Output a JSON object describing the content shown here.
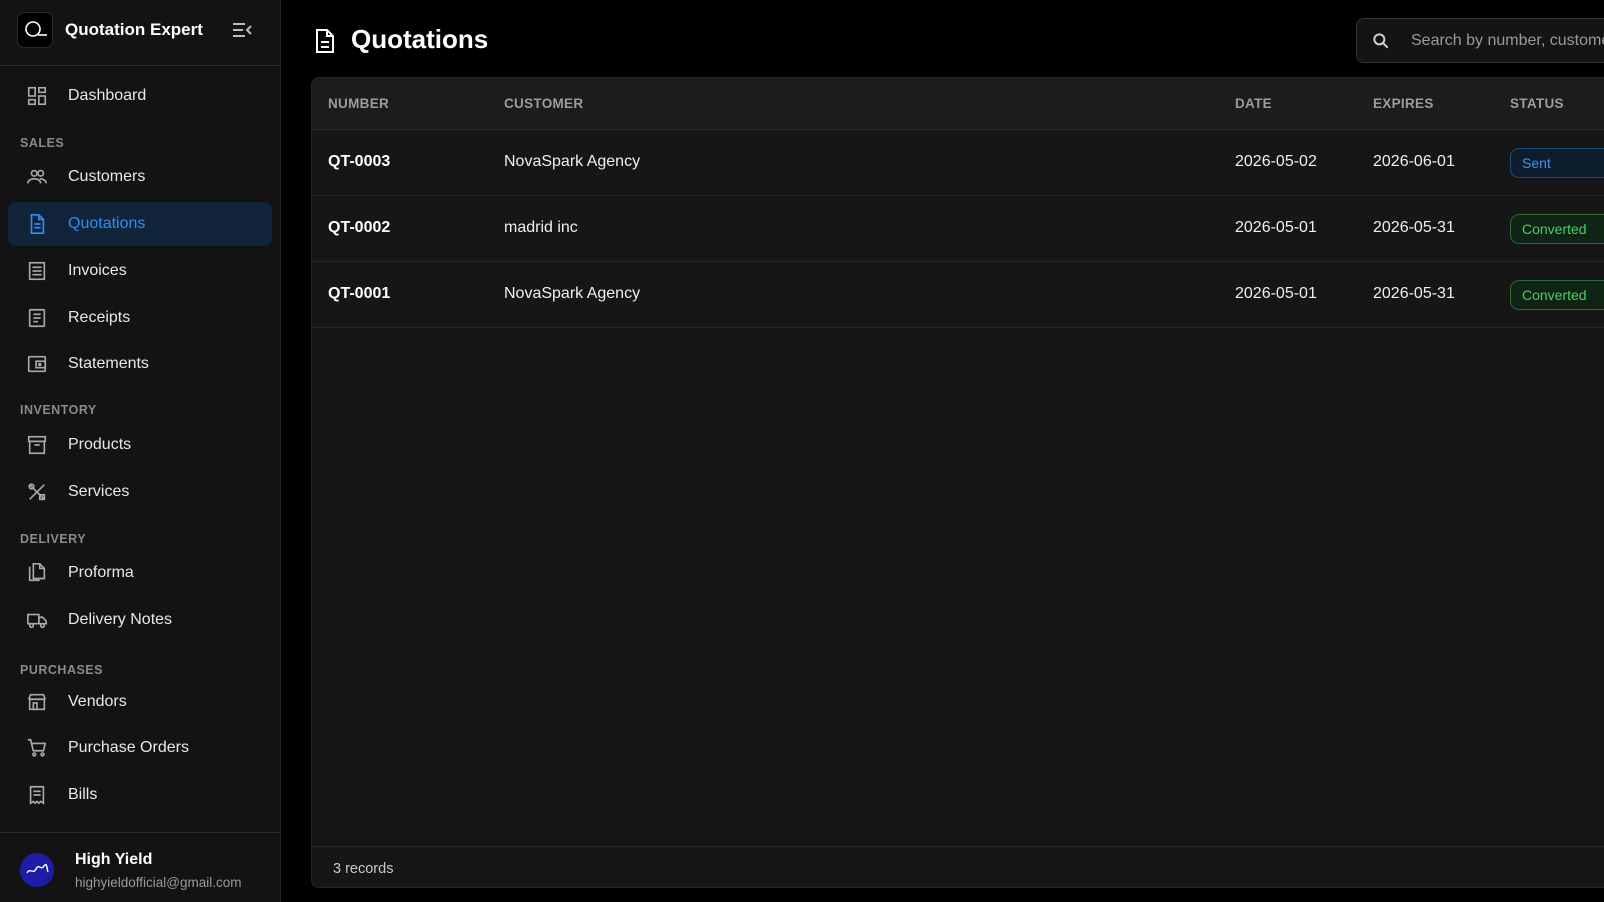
{
  "app": {
    "title": "Quotation Expert"
  },
  "sidebar": {
    "dashboard": "Dashboard",
    "sections": {
      "sales": "SALES",
      "inventory": "INVENTORY",
      "delivery": "DELIVERY",
      "purchases": "PURCHASES"
    },
    "items": {
      "customers": "Customers",
      "quotations": "Quotations",
      "invoices": "Invoices",
      "receipts": "Receipts",
      "statements": "Statements",
      "products": "Products",
      "services": "Services",
      "proforma": "Proforma",
      "delivery_notes": "Delivery Notes",
      "vendors": "Vendors",
      "purchase_orders": "Purchase Orders",
      "bills": "Bills"
    },
    "active_item": "Quotations",
    "accent_color": "#2f8df5"
  },
  "user": {
    "name": "High Yield",
    "email": "highyieldofficial@gmail.com"
  },
  "page": {
    "title": "Quotations"
  },
  "search": {
    "placeholder": "Search by number, customer..."
  },
  "table": {
    "headers": {
      "number": "NUMBER",
      "customer": "CUSTOMER",
      "date": "DATE",
      "expires": "EXPIRES",
      "status": "STATUS"
    },
    "rows": [
      {
        "number": "QT-0003",
        "customer": "NovaSpark Agency",
        "date": "2026-05-02",
        "expires": "2026-06-01",
        "status": "Sent"
      },
      {
        "number": "QT-0002",
        "customer": "madrid inc",
        "date": "2026-05-01",
        "expires": "2026-05-31",
        "status": "Converted"
      },
      {
        "number": "QT-0001",
        "customer": "NovaSpark Agency",
        "date": "2026-05-01",
        "expires": "2026-05-31",
        "status": "Converted"
      }
    ],
    "footer": "3 records"
  },
  "status_colors": {
    "Sent": "#3a93f5",
    "Converted": "#4ccd63"
  }
}
